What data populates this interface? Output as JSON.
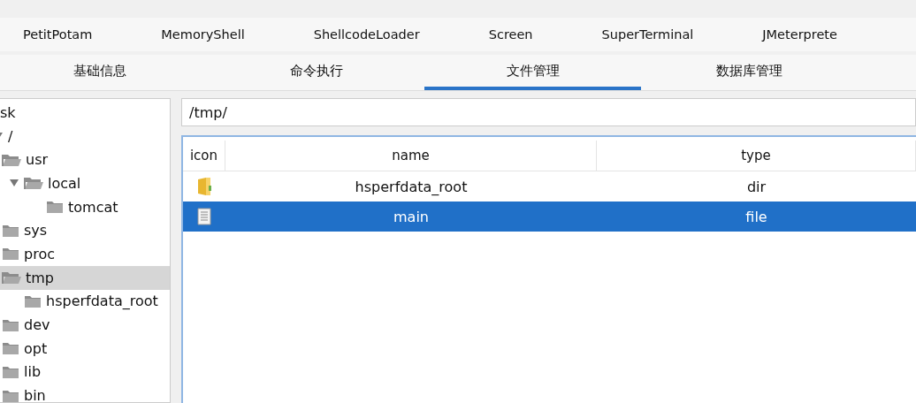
{
  "plugins": [
    {
      "label": "PetitPotam"
    },
    {
      "label": "MemoryShell"
    },
    {
      "label": "ShellcodeLoader"
    },
    {
      "label": "Screen"
    },
    {
      "label": "SuperTerminal"
    },
    {
      "label": "JMeterprete"
    }
  ],
  "tabs": [
    {
      "label": "基础信息",
      "selected": false
    },
    {
      "label": "命令执行",
      "selected": false
    },
    {
      "label": "文件管理",
      "selected": true
    },
    {
      "label": "数据库管理",
      "selected": false
    }
  ],
  "tree": [
    {
      "label": "sk",
      "selected": false,
      "children": [
        {
          "label": "/",
          "selected": false,
          "expanded": true,
          "children": [
            {
              "label": "usr",
              "selected": false,
              "expanded": true,
              "children": [
                {
                  "label": "local",
                  "selected": false,
                  "expanded": true,
                  "children": [
                    {
                      "label": "tomcat",
                      "selected": false
                    }
                  ]
                }
              ]
            },
            {
              "label": "sys",
              "selected": false
            },
            {
              "label": "proc",
              "selected": false
            },
            {
              "label": "tmp",
              "selected": true,
              "expanded": true,
              "children": [
                {
                  "label": "hsperfdata_root",
                  "selected": false
                }
              ]
            },
            {
              "label": "dev",
              "selected": false
            },
            {
              "label": "opt",
              "selected": false
            },
            {
              "label": "lib",
              "selected": false
            },
            {
              "label": "bin",
              "selected": false
            }
          ]
        }
      ]
    }
  ],
  "path_field": {
    "value": "/tmp/"
  },
  "table": {
    "columns": [
      "icon",
      "name",
      "type"
    ],
    "rows": [
      {
        "kind": "folder",
        "name": "hsperfdata_root",
        "type": "dir",
        "selected": false
      },
      {
        "kind": "file",
        "name": "main",
        "type": "file",
        "selected": true
      }
    ]
  }
}
